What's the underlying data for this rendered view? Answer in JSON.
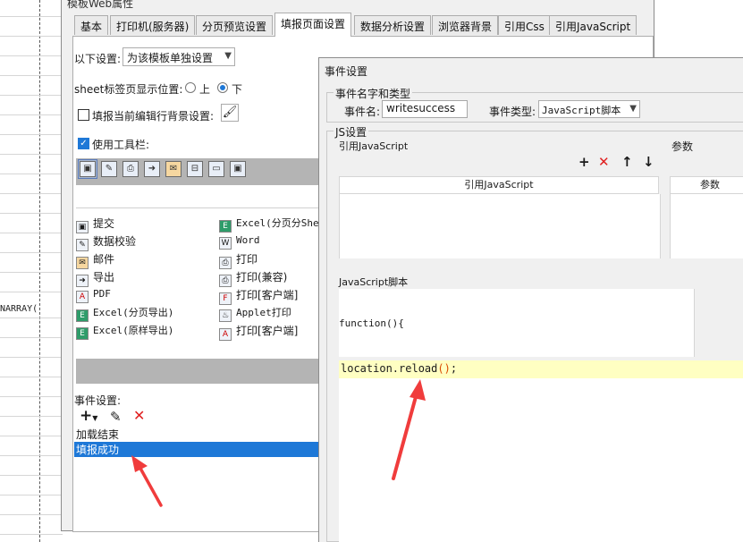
{
  "sheet": {
    "cell_text": "NARRAY("
  },
  "main_dialog": {
    "title": "模板Web属性",
    "tabs": [
      {
        "label": "基本"
      },
      {
        "label": "打印机(服务器)"
      },
      {
        "label": "分页预览设置"
      },
      {
        "label": "填报页面设置"
      },
      {
        "label": "数据分析设置"
      },
      {
        "label": "浏览器背景"
      },
      {
        "label": "引用Css"
      },
      {
        "label": "引用JavaScript"
      }
    ],
    "settings_label": "以下设置:",
    "settings_value": "为该模板单独设置",
    "sheet_pos_label": "sheet标签页显示位置:",
    "sheet_pos_top": "上",
    "sheet_pos_bottom": "下",
    "bg_label": "填报当前编辑行背景设置:",
    "use_toolbar_label": "使用工具栏:",
    "buttons_left": [
      {
        "label": "提交",
        "icon": "save-icon"
      },
      {
        "label": "数据校验",
        "icon": "pencil-icon"
      },
      {
        "label": "邮件",
        "icon": "mail-icon"
      },
      {
        "label": "导出",
        "icon": "export-icon"
      },
      {
        "label": "PDF",
        "icon": "pdf-icon"
      },
      {
        "label": "Excel(分页导出)",
        "icon": "excel-icon"
      },
      {
        "label": "Excel(原样导出)",
        "icon": "excel-icon"
      }
    ],
    "buttons_right": [
      {
        "label": "Excel(分页分She",
        "icon": "excel-icon"
      },
      {
        "label": "Word",
        "icon": "word-icon"
      },
      {
        "label": "打印",
        "icon": "printer-icon"
      },
      {
        "label": "打印(兼容)",
        "icon": "printer-icon"
      },
      {
        "label": "打印[客户端]",
        "icon": "flash-print-icon"
      },
      {
        "label": "Applet打印",
        "icon": "applet-icon"
      },
      {
        "label": "打印[客户端]",
        "icon": "pdf-print-icon"
      }
    ],
    "event_label": "事件设置:",
    "events": [
      {
        "label": "加载结束",
        "selected": false
      },
      {
        "label": "填报成功",
        "selected": true
      }
    ]
  },
  "event_dialog": {
    "title": "事件设置",
    "name_group": "事件名字和类型",
    "name_label": "事件名:",
    "name_value": "writesuccess",
    "type_label": "事件类型:",
    "type_value": "JavaScript脚本",
    "js_group": "JS设置",
    "ref_js_label": "引用JavaScript",
    "params_label": "参数",
    "ref_js_header": "引用JavaScript",
    "params_header": "参数",
    "script_label": "JavaScript脚本",
    "code_header": "function(){",
    "code_line": "location.reload();",
    "code_prefix": "location.reload",
    "code_parens": "()",
    "code_semicolon": ";"
  },
  "colors": {
    "accent": "#1e78d7",
    "annotation_arrow": "#f03c3c",
    "code_highlight": "#ffffc2",
    "delete_red": "#e02020"
  }
}
